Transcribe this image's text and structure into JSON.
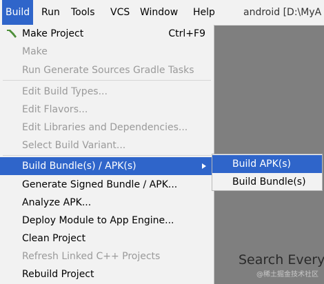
{
  "menubar": {
    "items": [
      "Build",
      "Run",
      "Tools",
      "VCS",
      "Window",
      "Help"
    ],
    "title": "android [D:\\MyA"
  },
  "build_menu": {
    "items": [
      {
        "label": "Make Project",
        "shortcut": "Ctrl+F9",
        "state": "enabled",
        "icon": "hammer-icon"
      },
      {
        "label": "Make",
        "state": "disabled"
      },
      {
        "label": "Run Generate Sources Gradle Tasks",
        "state": "disabled"
      },
      {
        "label": "Edit Build Types...",
        "state": "disabled"
      },
      {
        "label": "Edit Flavors...",
        "state": "disabled"
      },
      {
        "label": "Edit Libraries and Dependencies...",
        "state": "disabled"
      },
      {
        "label": "Select Build Variant...",
        "state": "disabled"
      },
      {
        "label": "Build Bundle(s) / APK(s)",
        "state": "selected",
        "submenu": true
      },
      {
        "label": "Generate Signed Bundle / APK...",
        "state": "enabled"
      },
      {
        "label": "Analyze APK...",
        "state": "enabled"
      },
      {
        "label": "Deploy Module to App Engine...",
        "state": "enabled"
      },
      {
        "label": "Clean Project",
        "state": "enabled"
      },
      {
        "label": "Refresh Linked C++ Projects",
        "state": "disabled"
      },
      {
        "label": "Rebuild Project",
        "state": "enabled"
      }
    ]
  },
  "submenu": {
    "items": [
      {
        "label": "Build APK(s)",
        "state": "selected"
      },
      {
        "label": "Build Bundle(s)",
        "state": "enabled"
      }
    ]
  },
  "editor": {
    "hint": "Search Every"
  },
  "watermark": "@稀土掘金技术社区",
  "colors": {
    "selection": "#2f65ca",
    "menu_bg": "#f2f2f2",
    "disabled_text": "#9a9a9a",
    "editor_bg": "#7f7f7f",
    "hammer": "#4e8f3a"
  }
}
